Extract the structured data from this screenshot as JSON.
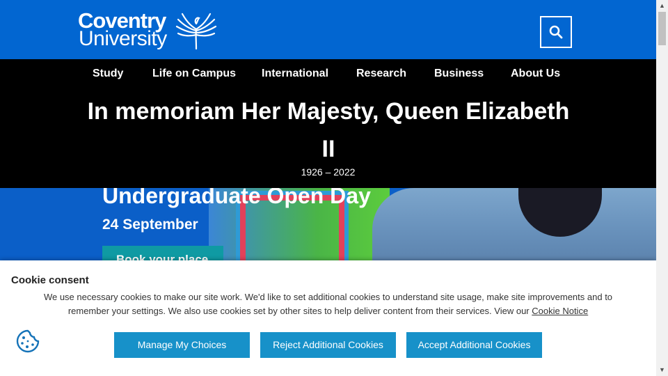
{
  "header": {
    "logo_line1": "Coventry",
    "logo_line2": "University",
    "search_icon": "search-icon",
    "background": "#0266d1"
  },
  "nav": {
    "items": [
      "Study",
      "Life on Campus",
      "International",
      "Research",
      "Business",
      "About Us"
    ]
  },
  "memorial": {
    "title": "In memoriam Her Majesty, Queen Elizabeth II",
    "dates": "1926 – 2022"
  },
  "hero": {
    "title": "Undergraduate Open Day",
    "date": "24 September",
    "button_label": "Book your place"
  },
  "cookie": {
    "title": "Cookie consent",
    "text": "We use necessary cookies to make our site work. We'd like to set additional cookies to understand site usage, make site improvements and to remember your settings. We also use cookies set by other sites to help deliver content from their services. View our ",
    "link_text": "Cookie Notice",
    "icon": "cookie-icon",
    "buttons": [
      "Manage My Choices",
      "Reject Additional Cookies",
      "Accept Additional Cookies"
    ],
    "button_color": "#1791c9"
  }
}
